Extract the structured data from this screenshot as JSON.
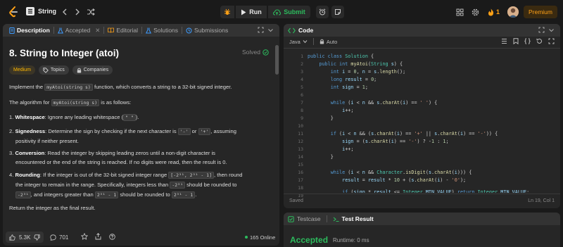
{
  "topbar": {
    "problem_list_label": "String",
    "run_label": "Run",
    "submit_label": "Submit",
    "streak_count": "1",
    "premium_label": "Premium"
  },
  "description": {
    "tabs": [
      "Description",
      "Accepted",
      "Editorial",
      "Solutions",
      "Submissions"
    ],
    "title": "8. String to Integer (atoi)",
    "solved_label": "Solved",
    "difficulty": "Medium",
    "topics_label": "Topics",
    "companies_label": "Companies",
    "intro_pre": "Implement the ",
    "intro_code": "myAtoi(string s)",
    "intro_post": " function, which converts a string to a 32-bit signed integer.",
    "algo_pre": "The algorithm for ",
    "algo_code": "myAtoi(string s)",
    "algo_post": " is as follows:",
    "s1_num": "1.",
    "s1_bold": "Whitespace",
    "s1_text": ": Ignore any leading whitespace (",
    "s1_code": "\" \"",
    "s1_end": ").",
    "s2_num": "2.",
    "s2_bold": "Signedness",
    "s2_text": ": Determine the sign by checking if the next character is ",
    "s2_code1": "'-'",
    "s2_or": " or ",
    "s2_code2": "'+'",
    "s2_end": ", assuming",
    "s2_line2": "positivity if neither present.",
    "s3_num": "3.",
    "s3_bold": "Conversion",
    "s3_text": ": Read the integer by skipping leading zeros until a non-digit character is",
    "s3_line2": "encountered or the end of the string is reached. If no digits were read, then the result is 0.",
    "s4_num": "4.",
    "s4_bold": "Rounding",
    "s4_text": ": If the integer is out of the 32-bit signed integer range ",
    "s4_code": "[-2³¹, 2³¹ - 1]",
    "s4_end": ", then round",
    "s4_line2": "the integer to remain in the range. Specifically, integers less than ",
    "s4_code2": "-2³¹",
    "s4_line2b": " should be rounded to",
    "s4_code3": "-2³¹",
    "s4_line3": ", and integers greater than ",
    "s4_code4": "2³¹ - 1",
    "s4_line3b": " should be rounded to ",
    "s4_code5": "2³¹ - 1",
    "s4_line3c": ".",
    "return_text": "Return the integer as the final result.",
    "likes": "5.3K",
    "comments": "701",
    "online": "165 Online"
  },
  "editor": {
    "title": "Code",
    "language": "Java",
    "mode": "Auto",
    "saved": "Saved",
    "cursor": "Ln 19, Col 1",
    "line_numbers": [
      "1",
      "2",
      "3",
      "4",
      "5",
      "6",
      "7",
      "8",
      "9",
      "10",
      "11",
      "12",
      "13",
      "14",
      "15",
      "16",
      "17",
      "18",
      "19"
    ]
  },
  "result": {
    "testcase_tab": "Testcase",
    "result_tab": "Test Result",
    "status": "Accepted",
    "runtime": "Runtime: 0 ms"
  }
}
